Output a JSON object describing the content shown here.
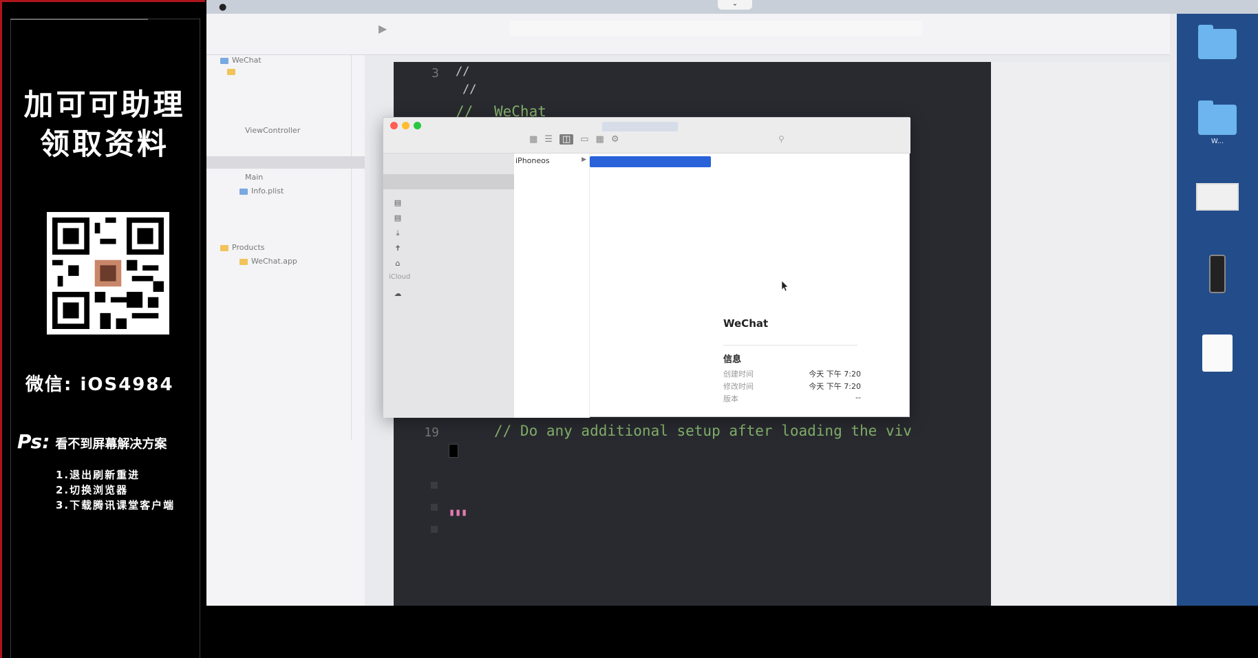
{
  "promo": {
    "title_line1": "加可可助理",
    "title_line2": "领取资料",
    "wechat_id": "微信: iOS4984",
    "ps_label": "Ps:",
    "ps_text": "看不到屏幕解决方案",
    "ps_steps": [
      "1.退出刷新重进",
      "2.切换浏览器",
      "3.下载腾讯课堂客户端"
    ]
  },
  "navigator": {
    "items": [
      "WeChat",
      "ViewController",
      "Main",
      "Info.plist",
      "Products",
      "WeChat.app"
    ]
  },
  "editor": {
    "lines": [
      {
        "num": "3",
        "text": "//",
        "muted": true
      },
      {
        "num": "",
        "text": "//",
        "muted": true
      },
      {
        "num": "",
        "text": "WeChat",
        "muted": false,
        "prefix": "//"
      },
      {
        "num": "19",
        "text": "// Do any additional setup after loading the viv"
      }
    ]
  },
  "finder": {
    "sidebar_section": "iCloud",
    "column_selected": "iPhoneos",
    "preview": {
      "name": "WeChat",
      "info_heading": "信息",
      "rows": [
        {
          "key": "创建时间",
          "value": "今天 下午 7:20"
        },
        {
          "key": "修改时间",
          "value": "今天 下午 7:20"
        },
        {
          "key": "版本",
          "value": "--"
        }
      ]
    }
  },
  "desktop_icons": [
    {
      "type": "folder"
    },
    {
      "type": "folder",
      "label": "W..."
    },
    {
      "type": "image"
    },
    {
      "type": "phone"
    },
    {
      "type": "doc"
    }
  ],
  "colors": {
    "promo_border": "#b0141b",
    "editor_bg": "#292a30",
    "code_comment": "#84b36b",
    "selection": "#2962d9"
  }
}
